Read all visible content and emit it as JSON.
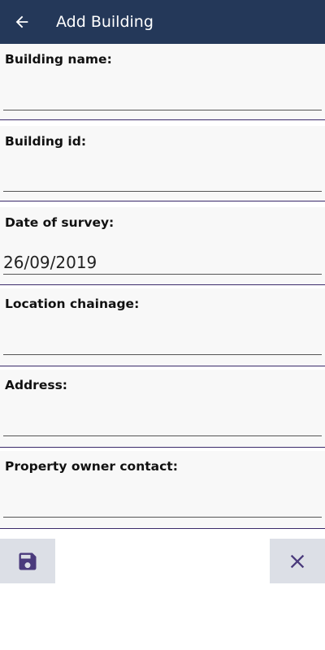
{
  "header": {
    "title": "Add Building",
    "back_icon": "arrow-left-icon"
  },
  "fields": [
    {
      "label": "Building name:",
      "value": ""
    },
    {
      "label": "Building id:",
      "value": ""
    },
    {
      "label": "Date of survey:",
      "value": "26/09/2019"
    },
    {
      "label": "Location chainage:",
      "value": ""
    },
    {
      "label": "Address:",
      "value": ""
    },
    {
      "label": "Property owner contact:",
      "value": ""
    }
  ],
  "actions": {
    "save_icon": "save-icon",
    "cancel_icon": "close-icon"
  },
  "colors": {
    "appbar": "#243859",
    "accent": "#4a3a7c",
    "button_bg": "#dcdfe6"
  }
}
